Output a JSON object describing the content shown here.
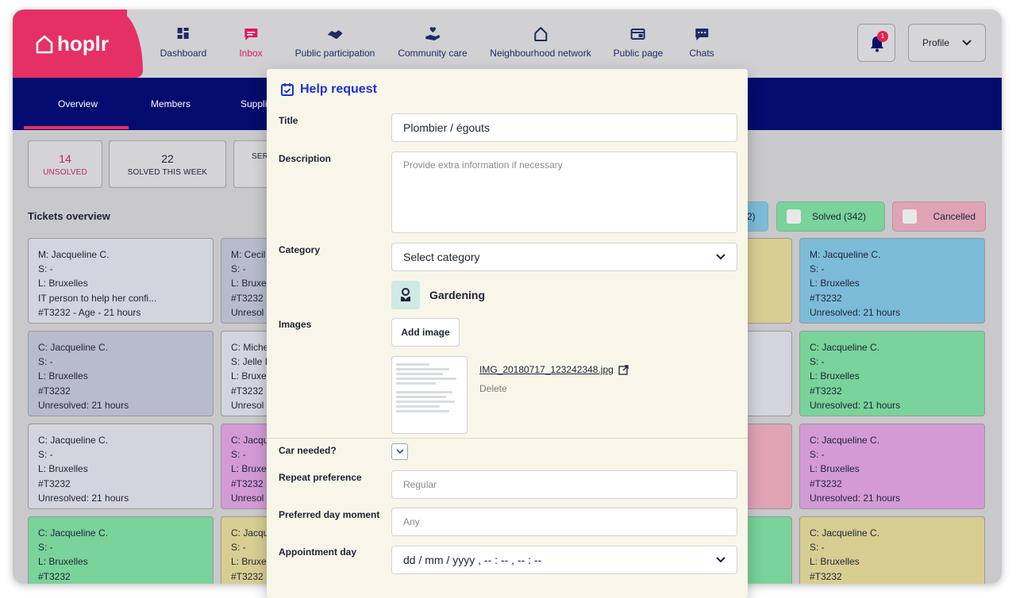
{
  "app": {
    "logo": "hoplr"
  },
  "nav": {
    "items": [
      {
        "label": "Dashboard",
        "icon": "dashboard-icon"
      },
      {
        "label": "Inbox",
        "icon": "inbox-icon"
      },
      {
        "label": "Public participation",
        "icon": "handshake-icon"
      },
      {
        "label": "Community care",
        "icon": "care-icon"
      },
      {
        "label": "Neighbourhood network",
        "icon": "house-icon"
      },
      {
        "label": "Public page",
        "icon": "page-icon"
      },
      {
        "label": "Chats",
        "icon": "chat-icon"
      }
    ],
    "active": "Inbox",
    "notification_count": "1",
    "profile_label": "Profile"
  },
  "subnav": {
    "items": [
      "Overview",
      "Members",
      "Suppli"
    ]
  },
  "stats": [
    {
      "value": "14",
      "label": "UNSOLVED"
    },
    {
      "value": "22",
      "label": "SOLVED THIS WEEK"
    },
    {
      "value": "",
      "label": "SER"
    }
  ],
  "tickets_title": "Tickets overview",
  "filters": [
    {
      "label": "2)"
    },
    {
      "label": "Solved (342)"
    },
    {
      "label": "Cancelled"
    }
  ],
  "tickets": {
    "col1": [
      [
        "M: Jacqueline C.",
        "S: -",
        "L: Bruxelles",
        "IT person to help her confi...",
        "#T3232 -  Age - 21 hours"
      ],
      [
        "C: Jacqueline C.",
        "S: -",
        "L: Bruxelles",
        "#T3232",
        "Unresolved: 21 hours"
      ],
      [
        "C: Jacqueline C.",
        "S: -",
        "L: Bruxelles",
        "#T3232",
        "Unresolved: 21 hours"
      ],
      [
        "C: Jacqueline C.",
        "S: -",
        "L: Bruxelles",
        "#T3232",
        ""
      ]
    ],
    "col2": [
      [
        "M: Cecil",
        "S: -",
        "L: Bruxe",
        "#T3232",
        "Unresol"
      ],
      [
        "C: Miche",
        "S: Jelle I",
        "L: Bruxe",
        "#T3232",
        "Unresol"
      ],
      [
        "C: Jacqu",
        "S: -",
        "L: Bruxe",
        "#T3232",
        "Unresol"
      ],
      [
        "C: Jacqu",
        "S: -",
        "L: Bruxe",
        "#T3232",
        ""
      ]
    ],
    "col4": [
      [
        "M: Jacqueline C.",
        "S: -",
        "L: Bruxelles",
        "#T3232",
        "Unresolved: 21 hours"
      ],
      [
        "C: Jacqueline C.",
        "S: -",
        "L: Bruxelles",
        "#T3232",
        "Unresolved: 21 hours"
      ],
      [
        "C: Jacqueline C.",
        "S: -",
        "L: Bruxelles",
        "#T3232",
        "Unresolved: 21 hours"
      ],
      [
        "C: Jacqueline C.",
        "S: -",
        "L: Bruxelles",
        "#T3232",
        ""
      ]
    ]
  },
  "modal": {
    "title": "Help request",
    "title_label": "Title",
    "title_value": "Plombier / égouts",
    "description_label": "Description",
    "description_placeholder": "Provide extra information if necessary",
    "category_label": "Category",
    "category_value": "Select category",
    "category_tag": "Gardening",
    "images_label": "Images",
    "add_image": "Add image",
    "file_name": "IMG_20180717_123242348.jpg",
    "delete": "Delete",
    "car_label": "Car needed?",
    "repeat_label": "Repeat preference",
    "repeat_placeholder": "Regular",
    "moment_label": "Preferred day moment",
    "moment_placeholder": "Any",
    "appointment_label": "Appointment day",
    "appointment_value": "dd / mm / yyyy , -- : -- ,  -- : --"
  },
  "colors": {
    "brand_pink": "#e53066",
    "subnav_navy": "#030b6e",
    "modal_title_blue": "#1c32d6",
    "ticket_gray": "#d4d4de",
    "ticket_slate": "#b7bccc",
    "ticket_green": "#79d39a",
    "ticket_purple": "#d49ad6",
    "ticket_blue": "#7cbcd8",
    "ticket_yellow": "#d8ce92",
    "ticket_pink": "#e0a3b6"
  }
}
